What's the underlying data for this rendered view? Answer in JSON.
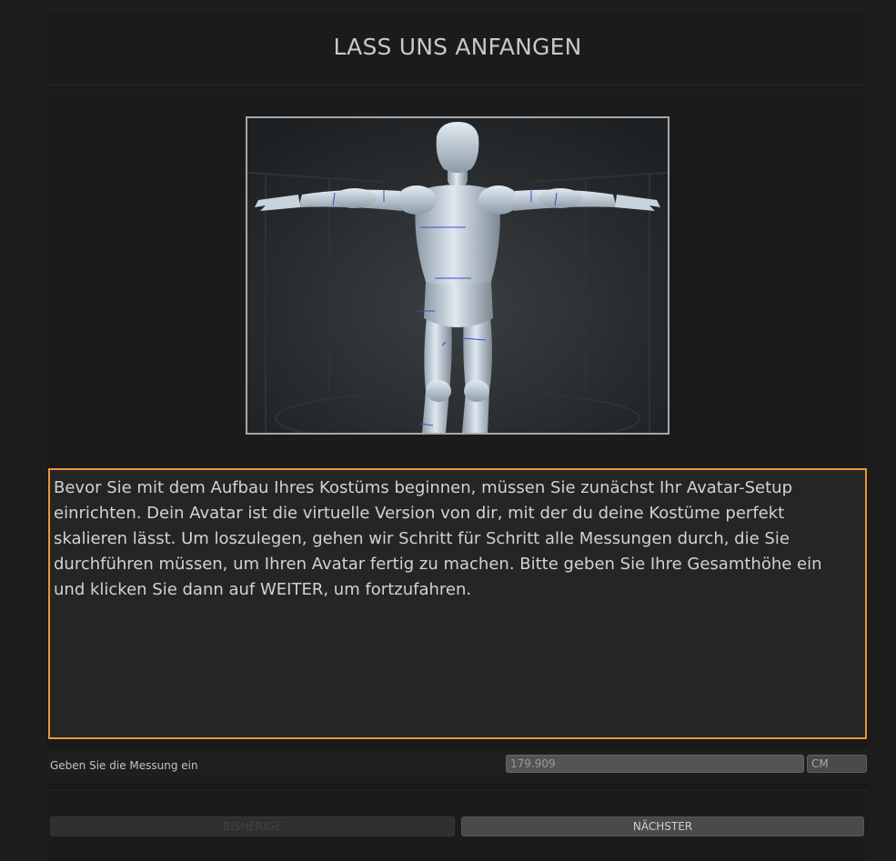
{
  "header": {
    "title": "LASS UNS ANFANGEN"
  },
  "preview": {
    "description": "3D avatar mannequin in T-pose",
    "icon": "avatar-preview-image"
  },
  "description": {
    "text": "Bevor Sie mit dem Aufbau Ihres Kostüms beginnen, müssen Sie zunächst Ihr Avatar-Setup einrichten. Dein Avatar ist die virtuelle Version von dir, mit der du deine Kostüme perfekt skalieren lässt. Um loszulegen, gehen wir Schritt für Schritt alle Messungen durch, die Sie durchführen müssen, um Ihren Avatar fertig zu machen. Bitte geben Sie Ihre Gesamthöhe ein und klicken Sie dann auf WEITER, um fortzufahren."
  },
  "measurement": {
    "label": "Geben Sie die Messung ein",
    "value": "179.909",
    "unit": "CM"
  },
  "navigation": {
    "prev_label": "BISHERIGE",
    "next_label": "NÄCHSTER"
  },
  "colors": {
    "accent": "#e8963a",
    "background": "#1c1c1c",
    "panel": "#252525"
  }
}
